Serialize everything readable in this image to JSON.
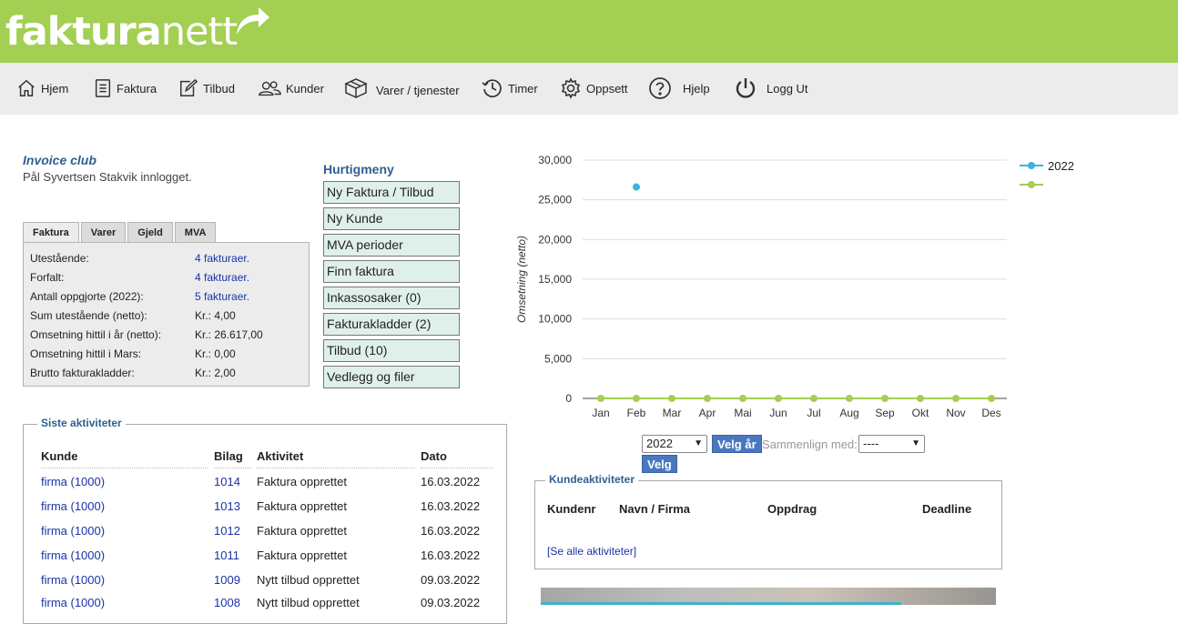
{
  "brand": {
    "part1": "faktura",
    "part2": "nett"
  },
  "nav": [
    {
      "id": "home",
      "label": "Hjem",
      "icon": "home-icon"
    },
    {
      "id": "invoice",
      "label": "Faktura",
      "icon": "document-icon"
    },
    {
      "id": "offer",
      "label": "Tilbud",
      "icon": "edit-icon"
    },
    {
      "id": "customers",
      "label": "Kunder",
      "icon": "users-icon"
    },
    {
      "id": "products",
      "label": "Varer / tjenester",
      "icon": "box-icon"
    },
    {
      "id": "hours",
      "label": "Timer",
      "icon": "clock-icon"
    },
    {
      "id": "settings",
      "label": "Oppsett",
      "icon": "gear-icon"
    },
    {
      "id": "help",
      "label": "Hjelp",
      "icon": "question-icon"
    },
    {
      "id": "logout",
      "label": "Logg Ut",
      "icon": "power-icon"
    }
  ],
  "user": {
    "club": "Invoice club",
    "logged_in": "Pål Syvertsen Stakvik innlogget."
  },
  "tabs": [
    "Faktura",
    "Varer",
    "Gjeld",
    "MVA"
  ],
  "stats": [
    {
      "label": "Utestående:",
      "value": "4 fakturaer.",
      "link": true
    },
    {
      "label": "Forfalt:",
      "value": "4 fakturaer.",
      "link": true
    },
    {
      "label": "Antall oppgjorte (2022):",
      "value": "5 fakturaer.",
      "link": true
    },
    {
      "label": "Sum utestående (netto):",
      "value": "Kr.: 4,00",
      "link": false
    },
    {
      "label": "Omsetning hittil i år (netto):",
      "value": "Kr.: 26.617,00",
      "link": false
    },
    {
      "label": "Omsetning hittil i Mars:",
      "value": "Kr.: 0,00",
      "link": false
    },
    {
      "label": "Brutto fakturakladder:",
      "value": "Kr.: 2,00",
      "link": false
    }
  ],
  "quickmenu": {
    "title": "Hurtigmeny",
    "items": [
      "Ny Faktura / Tilbud",
      "Ny Kunde",
      "MVA perioder",
      "Finn faktura",
      "Inkassosaker (0)",
      "Fakturakladder (2)",
      "Tilbud (10)",
      "Vedlegg og filer"
    ]
  },
  "activities": {
    "title": "Siste aktiviteter",
    "headers": [
      "Kunde",
      "Bilag",
      "Aktivitet",
      "Dato"
    ],
    "rows": [
      [
        "firma (1000)",
        "1014",
        "Faktura opprettet",
        "16.03.2022"
      ],
      [
        "firma (1000)",
        "1013",
        "Faktura opprettet",
        "16.03.2022"
      ],
      [
        "firma (1000)",
        "1012",
        "Faktura opprettet",
        "16.03.2022"
      ],
      [
        "firma (1000)",
        "1011",
        "Faktura opprettet",
        "16.03.2022"
      ],
      [
        "firma (1000)",
        "1009",
        "Nytt tilbud opprettet",
        "09.03.2022"
      ],
      [
        "firma (1000)",
        "1008",
        "Nytt tilbud opprettet",
        "09.03.2022"
      ]
    ]
  },
  "chart_data": {
    "type": "line",
    "categories": [
      "Jan",
      "Feb",
      "Mar",
      "Apr",
      "Mai",
      "Jun",
      "Jul",
      "Aug",
      "Sep",
      "Okt",
      "Nov",
      "Des"
    ],
    "series": [
      {
        "name": "2022",
        "color": "#3ab4dc",
        "values": [
          null,
          26617,
          null,
          null,
          null,
          null,
          null,
          null,
          null,
          null,
          null,
          null
        ]
      },
      {
        "name": "",
        "color": "#a3cf52",
        "values": [
          0,
          0,
          0,
          0,
          0,
          0,
          0,
          0,
          0,
          0,
          0,
          0
        ]
      }
    ],
    "ylabel": "Omsetning (netto)",
    "yticks": [
      "0",
      "5,000",
      "10,000",
      "15,000",
      "20,000",
      "25,000",
      "30,000"
    ],
    "ylim": [
      0,
      30000
    ],
    "grid": true,
    "legend": "top-right"
  },
  "chart_controls": {
    "year_value": "2022",
    "velg_ar_label": "Velg år",
    "compare_label": "Sammenlign med:",
    "compare_value": "----",
    "velg_label": "Velg"
  },
  "customer_activities": {
    "title": "Kundeaktiviteter",
    "headers": [
      "Kundenr",
      "Navn / Firma",
      "Oppdrag",
      "Deadline"
    ],
    "see_all": "[Se alle aktiviteter]"
  }
}
